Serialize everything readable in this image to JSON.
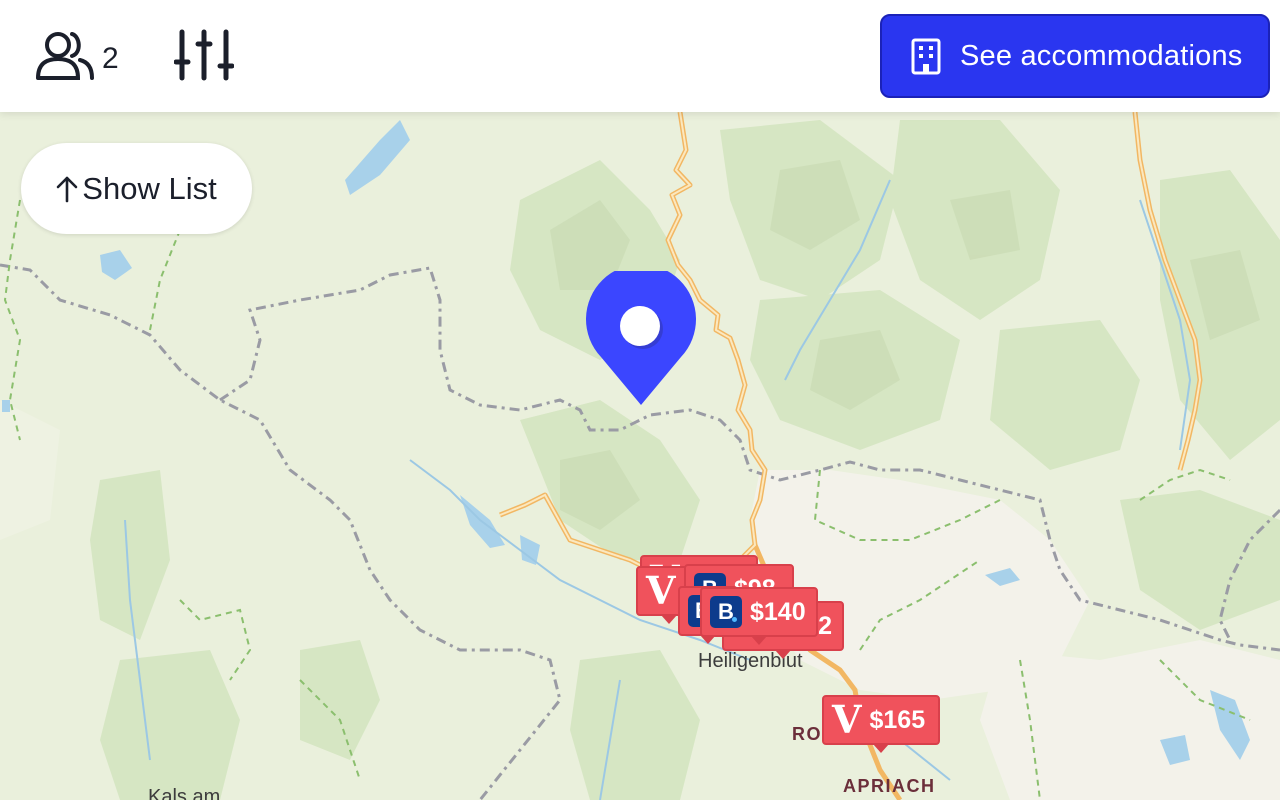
{
  "header": {
    "guests_icon": "users-icon",
    "guest_count": "2",
    "filters_icon": "sliders-icon",
    "accommodations_icon": "building-icon",
    "accommodations_label": "See accommodations"
  },
  "show_list": {
    "icon": "arrow-up-icon",
    "label": "Show List"
  },
  "map": {
    "places": [
      {
        "name": "Heiligenblut"
      },
      {
        "name": "ROS"
      },
      {
        "name": "APRIACH"
      },
      {
        "name": "Kals am"
      }
    ],
    "markers": [
      {
        "provider": "V",
        "price": ""
      },
      {
        "provider": "V",
        "price": ""
      },
      {
        "provider": "B",
        "price": "$98"
      },
      {
        "provider": "B",
        "price": ""
      },
      {
        "provider": "",
        "price": "2"
      },
      {
        "provider": "B",
        "price": "$140"
      },
      {
        "provider": "V",
        "price": "$165"
      }
    ],
    "pin_icon": "location-pin-icon"
  },
  "colors": {
    "accent": "#2a36f0",
    "marker": "#f0525c",
    "pin": "#3b46ff",
    "booking_logo": "#0d3b8c"
  }
}
